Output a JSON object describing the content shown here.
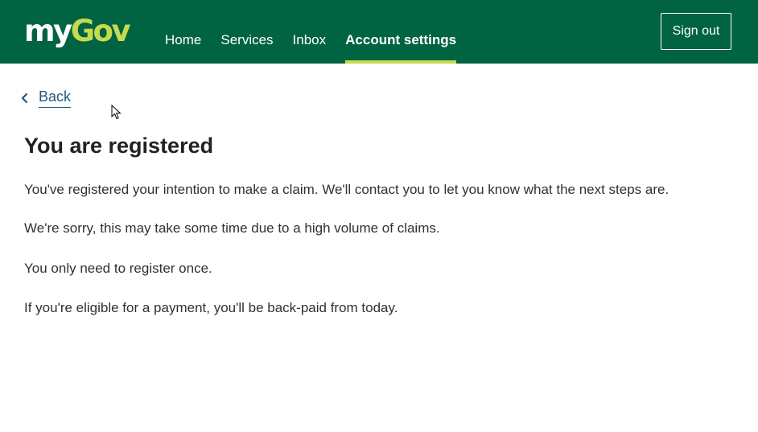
{
  "header": {
    "logo": {
      "my": "my",
      "gov": "Gov"
    },
    "nav": [
      {
        "label": "Home"
      },
      {
        "label": "Services"
      },
      {
        "label": "Inbox"
      },
      {
        "label": "Account settings",
        "active": true
      }
    ],
    "sign_out_label": "Sign out"
  },
  "back_link": {
    "label": "Back",
    "icon": "chevron-left-icon"
  },
  "page": {
    "title": "You are registered",
    "paragraphs": [
      "You've registered your intention to make a claim. We'll contact you to let you know what the next steps are.",
      "We're sorry, this may take some time due to a high volume of claims.",
      "You only need to register once.",
      "If you're eligible for a payment, you'll be back-paid from today."
    ]
  },
  "colors": {
    "header_bg": "#006341",
    "accent": "#c6da4e",
    "link": "#1d5b80",
    "text": "#313131"
  }
}
